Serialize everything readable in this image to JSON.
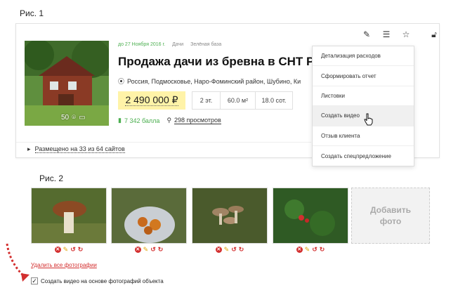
{
  "figures": {
    "fig1": "Рис. 1",
    "fig2": "Рис. 2"
  },
  "listing": {
    "date": "до 27 Ноября 2016 г.",
    "category": "Дачи",
    "base": "Зелёная база",
    "title": "Продажа дачи из бревна в СНТ Рад",
    "address": "Россия, Подмосковье, Наро-Фоминский район, Шубино, Ки",
    "price": "2 490 000 ₽",
    "params": [
      "2 эт.",
      "60.0 м²",
      "18.0 сот."
    ],
    "photo_count": "50",
    "score": "7 342 балла",
    "views": "298 просмотров",
    "placed": "Размещено на 33 из 64 сайтов"
  },
  "menu": {
    "items": [
      "Детализация расходов",
      "Сформировать отчет",
      "Листовки",
      "Создать видео",
      "Отзыв клиента",
      "Создать спецпредложение"
    ],
    "hovered_index": 3
  },
  "photos": {
    "add_label_1": "Добавить",
    "add_label_2": "фото",
    "delete_all": "Удалить все фотографии",
    "video_checkbox": "Создать видео на основе фотографий объекта",
    "video_checked": true
  },
  "colors": {
    "accent_green": "#4caf50",
    "price_bg": "#fff3a8",
    "danger": "#d32f2f"
  }
}
